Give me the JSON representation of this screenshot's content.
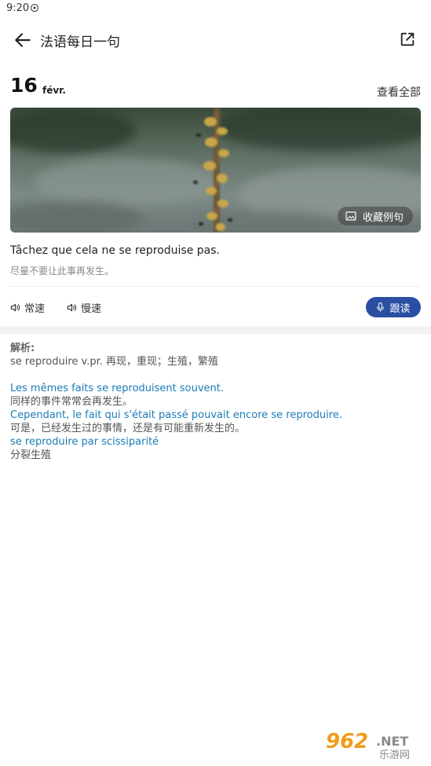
{
  "status_bar": {
    "time": "9:20"
  },
  "app_bar": {
    "title": "法语每日一句"
  },
  "date": {
    "day": "16",
    "month": "févr.",
    "view_all": "查看全部"
  },
  "hero": {
    "collect_label": "收藏例句"
  },
  "sentence": {
    "french": "Tâchez que cela ne se reproduise pas.",
    "chinese": "尽量不要让此事再发生。"
  },
  "audio": {
    "normal_label": "常速",
    "slow_label": "慢速",
    "follow_label": "跟读"
  },
  "analysis": {
    "label": "解析:",
    "definition": "se reproduire v.pr. 再现，重现；生殖，繁殖",
    "examples": [
      {
        "fr": "Les mêmes faits se reproduisent souvent.",
        "zh": "同样的事件常常会再发生。"
      },
      {
        "fr": "Cependant, le fait qui s'était passé pouvait encore se reproduire.",
        "zh": "可是，已经发生过的事情，还是有可能重新发生的。"
      },
      {
        "fr": "se reproduire par scissiparité",
        "zh": "分裂生殖"
      }
    ]
  },
  "watermark": {
    "number": "962",
    "suffix": ".NET",
    "site": "乐游网"
  },
  "colors": {
    "accent": "#2a4fa2",
    "link": "#1a7bb8"
  },
  "icons": [
    "sim-icon",
    "back-arrow-icon",
    "share-icon",
    "image-icon",
    "speaker-icon",
    "microphone-icon"
  ]
}
